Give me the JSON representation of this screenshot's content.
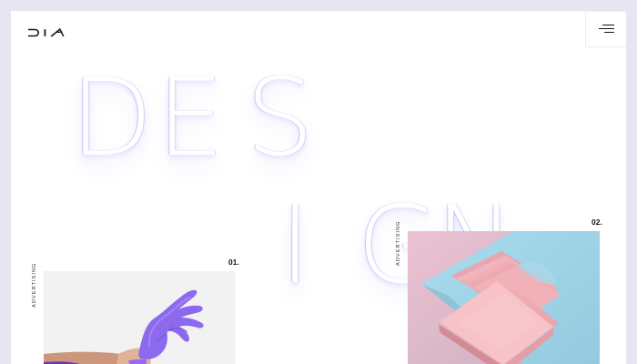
{
  "brand": {
    "logo_icon": "dia-logo-icon"
  },
  "navigation": {
    "menu_icon": "menu-icon"
  },
  "hero": {
    "letters": [
      "D",
      "E",
      "S",
      "I",
      "G",
      "N"
    ]
  },
  "projects": [
    {
      "number": "01.",
      "category": "ADVERTISING",
      "image_icon": "purple-hand-image"
    },
    {
      "number": "02.",
      "category": "ADVERTISING",
      "image_icon": "pink-business-cards-image"
    }
  ],
  "colors": {
    "page_background": "#ffffff",
    "outer_background": "#e7e5f2",
    "hero_shadow": "#7769f6",
    "purple_accent": "#8b66e8",
    "pink_accent": "#e9aeb4",
    "blue_accent": "#a9d8ea"
  }
}
